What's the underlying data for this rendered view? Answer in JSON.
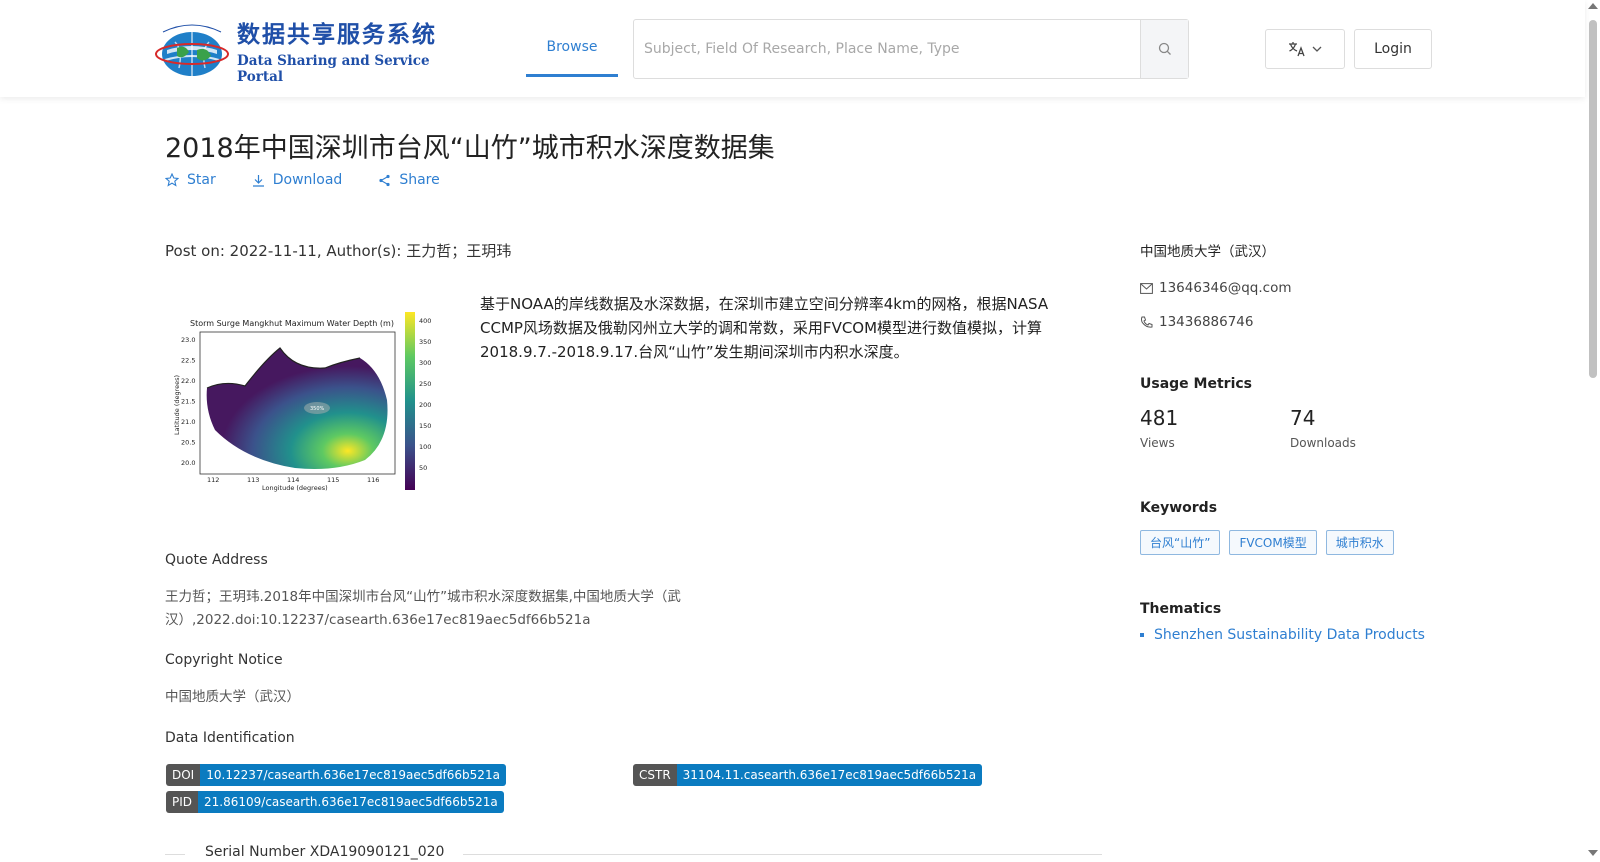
{
  "header": {
    "logo_cn": "数据共享服务系统",
    "logo_en": "Data Sharing and Service Portal",
    "nav_browse": "Browse",
    "search_placeholder": "Subject, Field Of Research, Place Name, Type",
    "login": "Login"
  },
  "dataset": {
    "title": "2018年中国深圳市台风“山竹”城市积水深度数据集",
    "actions": {
      "star": "Star",
      "download": "Download",
      "share": "Share"
    },
    "post_on": "Post on: 2022-11-11, Author(s): 王力哲；王玥玮",
    "description": "基于NOAA的岸线数据及水深数据，在深圳市建立空间分辨率4km的网格，根据NASA CCMP风场数据及俄勒冈州立大学的调和常数，采用FVCOM模型进行数值模拟，计算2018.9.7.-2018.9.17.台风“山竹”发生期间深圳市内积水深度。",
    "thumbnail": {
      "title": "Storm Surge Mangkhut Maximum Water Depth (m)",
      "xlabel": "Longitude (degrees)",
      "ylabel": "Latitude (degrees)",
      "xticks": [
        "112",
        "113",
        "114",
        "115",
        "116"
      ],
      "yticks": [
        "23.0",
        "22.5",
        "22.0",
        "21.5",
        "21.0",
        "20.5",
        "20.0"
      ],
      "cbar_ticks": [
        "400",
        "350",
        "300",
        "250",
        "200",
        "150",
        "100",
        "50"
      ],
      "center_label": "350%"
    },
    "quote_label": "Quote Address",
    "quote_text_1": "王力哲；王玥玮.2018年中国深圳市台风“山竹”城市积水深度数据集,中国地质大学（武",
    "quote_text_2": "汉）,2022.doi:10.12237/casearth.636e17ec819aec5df66b521a",
    "copyright_label": "Copyright Notice",
    "copyright_text": "中国地质大学（武汉）",
    "identification_label": "Data Identification",
    "doi_key": "DOI",
    "doi_val": "10.12237/casearth.636e17ec819aec5df66b521a",
    "cstr_key": "CSTR",
    "cstr_val": "31104.11.casearth.636e17ec819aec5df66b521a",
    "pid_key": "PID",
    "pid_val": "21.86109/casearth.636e17ec819aec5df66b521a",
    "serial": "Serial Number XDA19090121_020"
  },
  "sidebar": {
    "institution": "中国地质大学（武汉）",
    "email": "13646346@qq.com",
    "phone": "13436886746",
    "usage_title": "Usage Metrics",
    "views_count": "481",
    "views_label": "Views",
    "downloads_count": "74",
    "downloads_label": "Downloads",
    "keywords_title": "Keywords",
    "keywords": [
      "台风“山竹”",
      "FVCOM模型",
      "城市积水"
    ],
    "thematics_title": "Thematics",
    "thematic_item": "Shenzhen Sustainability Data Products"
  },
  "colors": {
    "accent": "#2f7fd1",
    "badge_blue": "#0b7bc0",
    "badge_gray": "#555555"
  }
}
